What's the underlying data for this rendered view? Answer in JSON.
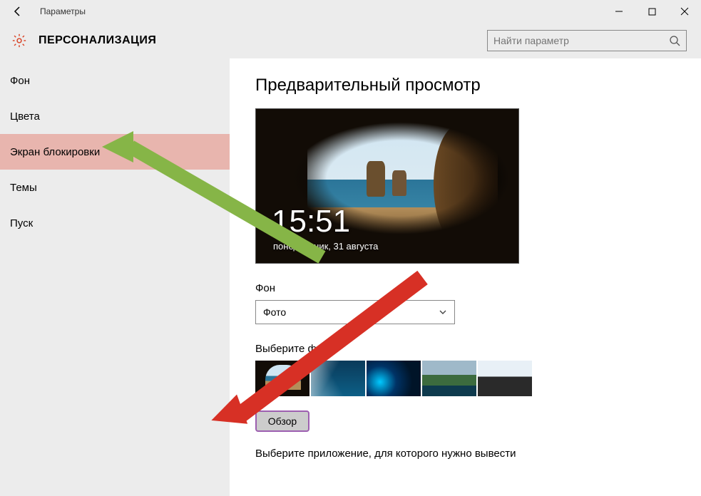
{
  "window": {
    "title": "Параметры"
  },
  "header": {
    "title": "ПЕРСОНАЛИЗАЦИЯ",
    "search_placeholder": "Найти параметр"
  },
  "sidebar": {
    "items": [
      {
        "label": "Фон"
      },
      {
        "label": "Цвета"
      },
      {
        "label": "Экран блокировки"
      },
      {
        "label": "Темы"
      },
      {
        "label": "Пуск"
      }
    ],
    "selected_index": 2
  },
  "content": {
    "preview_heading": "Предварительный просмотр",
    "clock_time": "15:51",
    "clock_date": "понедельник, 31 августа",
    "background_label": "Фон",
    "background_value": "Фото",
    "choose_photo_label": "Выберите фото",
    "browse_label": "Обзор",
    "app_prompt": "Выберите приложение, для которого нужно вывести"
  }
}
